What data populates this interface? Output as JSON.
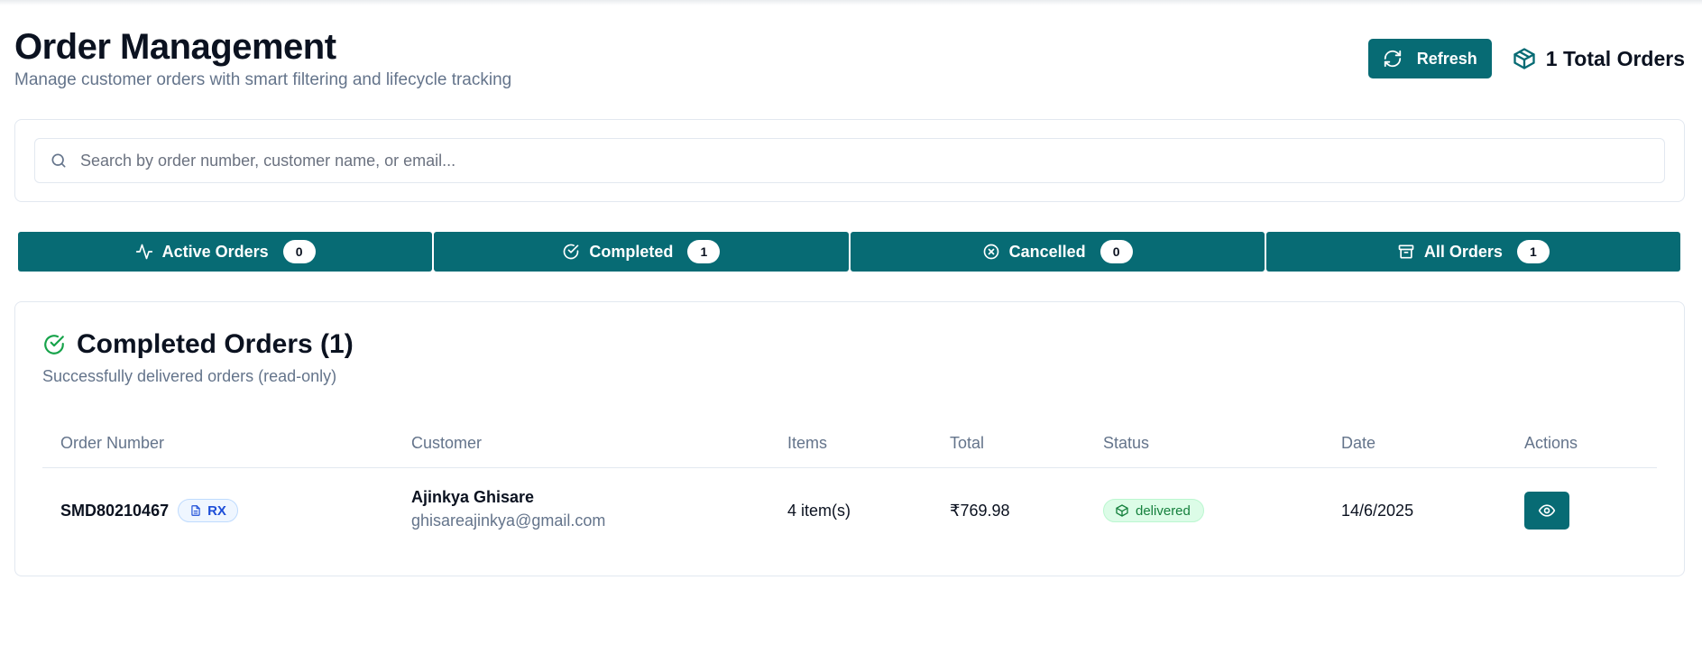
{
  "header": {
    "title": "Order Management",
    "subtitle": "Manage customer orders with smart filtering and lifecycle tracking",
    "refresh_label": "Refresh",
    "total_orders": "1 Total Orders"
  },
  "search": {
    "placeholder": "Search by order number, customer name, or email...",
    "value": ""
  },
  "tabs": [
    {
      "label": "Active Orders",
      "count": "0",
      "icon": "activity-icon"
    },
    {
      "label": "Completed",
      "count": "1",
      "icon": "check-circle-icon"
    },
    {
      "label": "Cancelled",
      "count": "0",
      "icon": "x-circle-icon"
    },
    {
      "label": "All Orders",
      "count": "1",
      "icon": "archive-icon"
    }
  ],
  "section": {
    "title": "Completed Orders (1)",
    "subtitle": "Successfully delivered orders (read-only)"
  },
  "table": {
    "columns": [
      "Order Number",
      "Customer",
      "Items",
      "Total",
      "Status",
      "Date",
      "Actions"
    ],
    "rows": [
      {
        "order_number": "SMD80210467",
        "badge": "RX",
        "customer_name": "Ajinkya Ghisare",
        "customer_email": "ghisareajinkya@gmail.com",
        "items": "4 item(s)",
        "total": "₹769.98",
        "status": "delivered",
        "date": "14/6/2025",
        "action_icon": "eye-icon"
      }
    ]
  },
  "colors": {
    "primary": "#076b74",
    "status_delivered_bg": "#dcfce7",
    "status_delivered_text": "#15803d",
    "rx_badge_text": "#1d4ed8",
    "success_icon": "#16a34a"
  }
}
